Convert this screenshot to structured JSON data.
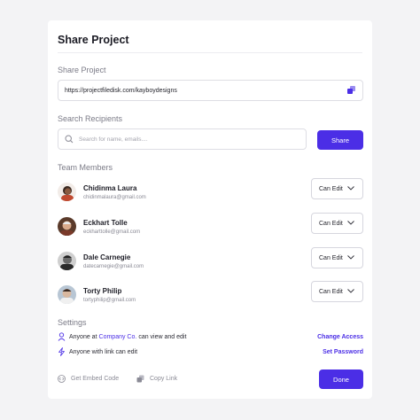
{
  "dialog": {
    "title": "Share Project"
  },
  "share_project": {
    "label": "Share Project",
    "url": "https://projectfiledisk.com/kayboydesigns"
  },
  "recipients": {
    "label": "Search Recipients",
    "placeholder": "Search for name, emails....",
    "share_label": "Share"
  },
  "team": {
    "label": "Team Members",
    "members": [
      {
        "name": "Chidinma Laura",
        "email": "chidinmalaura@gmail.com",
        "permission": "Can Edit"
      },
      {
        "name": "Eckhart Tolle",
        "email": "eckharttolle@gmail.com",
        "permission": "Can Edit"
      },
      {
        "name": "Dale Carnegie",
        "email": "datecarnegie@gmail.com",
        "permission": "Can Edit"
      },
      {
        "name": "Torty Philip",
        "email": "tortyphilip@gmail.com",
        "permission": "Can Edit"
      }
    ]
  },
  "settings": {
    "label": "Settings",
    "access": {
      "prefix": "Anyone at",
      "org": "Company Co.",
      "suffix": "can view and edit",
      "action": "Change Access"
    },
    "link": {
      "text": "Anyone with link can edit",
      "action": "Set Password"
    }
  },
  "footer": {
    "embed_label": "Get Embed Code",
    "copy_label": "Copy Link",
    "done_label": "Done"
  },
  "colors": {
    "accent": "#4b2ee6",
    "card": "#ffffff",
    "background": "#f3f3f5"
  },
  "icons": [
    "copy-icon",
    "search-icon",
    "chevron-down-icon",
    "user-icon",
    "bolt-icon",
    "embed-icon"
  ]
}
